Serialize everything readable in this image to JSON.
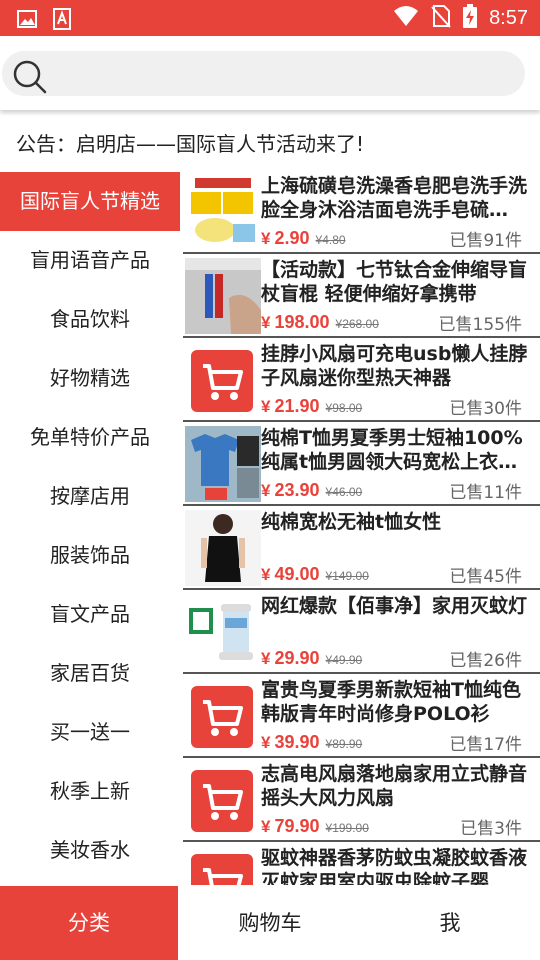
{
  "status_bar": {
    "time": "8:57",
    "left_icons": [
      "image-icon",
      "pdf-app-icon"
    ],
    "right_icons": [
      "wifi-icon",
      "no-sim-icon",
      "battery-charging-icon"
    ]
  },
  "search": {
    "placeholder": ""
  },
  "notice": "公告：启明店——国际盲人节活动来了!",
  "sidebar": {
    "items": [
      {
        "label": "国际盲人节精选",
        "active": true
      },
      {
        "label": "盲用语音产品"
      },
      {
        "label": "食品饮料"
      },
      {
        "label": "好物精选"
      },
      {
        "label": "免单特价产品"
      },
      {
        "label": "按摩店用"
      },
      {
        "label": "服装饰品"
      },
      {
        "label": "盲文产品"
      },
      {
        "label": "家居百货"
      },
      {
        "label": "买一送一"
      },
      {
        "label": "秋季上新"
      },
      {
        "label": "美妆香水"
      }
    ]
  },
  "products": [
    {
      "title": "上海硫磺皂洗澡香皂肥皂洗手洗脸全身沐浴洁面皂洗手皂硫…",
      "currency": "¥",
      "price": "2.90",
      "original": "¥4.80",
      "sold": "已售91件",
      "image": "soap-photo"
    },
    {
      "title": "【活动款】七节钛合金伸缩导盲杖盲棍 轻便伸缩好拿携带",
      "currency": "¥",
      "price": "198.00",
      "original": "¥268.00",
      "sold": "已售155件",
      "image": "cane-photo"
    },
    {
      "title": "挂脖小风扇可充电usb懒人挂脖子风扇迷你型热天神器",
      "currency": "¥",
      "price": "21.90",
      "original": "¥98.00",
      "sold": "已售30件",
      "image": "cart-placeholder"
    },
    {
      "title": "纯棉T恤男夏季男士短袖100%纯属t恤男圆领大码宽松上衣…",
      "currency": "¥",
      "price": "23.90",
      "original": "¥46.00",
      "sold": "已售11件",
      "image": "tshirt-photo"
    },
    {
      "title": "纯棉宽松无袖t恤女性",
      "currency": "¥",
      "price": "49.00",
      "original": "¥149.00",
      "sold": "已售45件",
      "image": "tank-top-photo"
    },
    {
      "title": "网红爆款【佰事净】家用灭蚊灯",
      "currency": "¥",
      "price": "29.90",
      "original": "¥49.90",
      "sold": "已售26件",
      "image": "mosquito-lamp-photo"
    },
    {
      "title": "富贵鸟夏季男新款短袖T恤纯色韩版青年时尚修身POLO衫",
      "currency": "¥",
      "price": "39.90",
      "original": "¥89.90",
      "sold": "已售17件",
      "image": "cart-placeholder"
    },
    {
      "title": "志高电风扇落地扇家用立式静音摇头大风力风扇",
      "currency": "¥",
      "price": "79.90",
      "original": "¥199.00",
      "sold": "已售3件",
      "image": "cart-placeholder"
    },
    {
      "title": "驱蚊神器香茅防蚊虫凝胶蚊香液灭蚊家用室内驱虫除蚊子婴",
      "currency": "¥",
      "price": "",
      "original": "",
      "sold": "",
      "image": "cart-placeholder"
    }
  ],
  "bottom_nav": {
    "tabs": [
      {
        "label": "分类",
        "active": true
      },
      {
        "label": "购物车"
      },
      {
        "label": "我"
      }
    ]
  },
  "colors": {
    "accent": "#e8433a",
    "divider": "#555555"
  }
}
